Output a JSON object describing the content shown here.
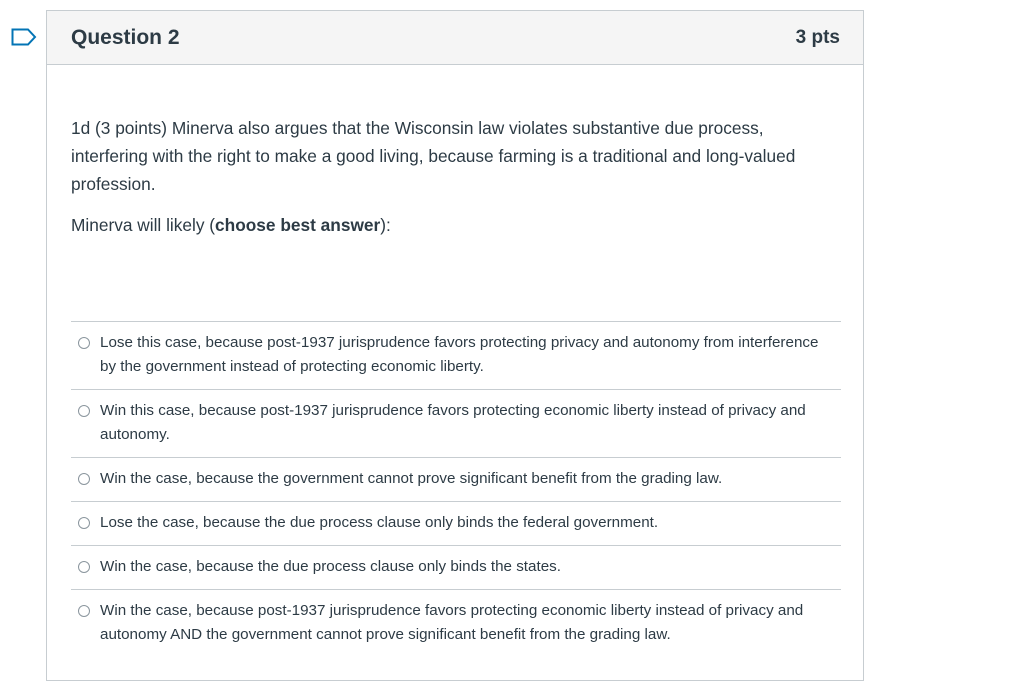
{
  "question": {
    "title": "Question 2",
    "points": "3 pts",
    "text": "1d (3 points) Minerva also argues that the Wisconsin law violates substantive due process, interfering with the right to make a good living, because farming is a traditional and long-valued profession.",
    "prompt_prefix": "Minerva will likely (",
    "prompt_bold": "choose best answer",
    "prompt_suffix": "):",
    "flagged": false
  },
  "answers": [
    {
      "label": "Lose this case, because post-1937 jurisprudence favors protecting privacy and autonomy from interference by the government instead of protecting economic liberty.",
      "selected": false
    },
    {
      "label": "Win this case, because post-1937 jurisprudence favors protecting economic liberty instead of privacy and autonomy.",
      "selected": false
    },
    {
      "label": "Win the case, because the government cannot prove significant benefit from the grading law.",
      "selected": false
    },
    {
      "label": "Lose the case, because the due process clause only binds the federal government.",
      "selected": false
    },
    {
      "label": "Win the case, because the due process clause only binds the states.",
      "selected": false
    },
    {
      "label": "Win the case, because post-1937 jurisprudence favors protecting economic liberty instead of privacy and autonomy AND the government cannot prove significant benefit from the grading law.",
      "selected": false
    }
  ],
  "colors": {
    "accent": "#0374b5",
    "text": "#2d3b45",
    "border": "#c7cdd1",
    "header_bg": "#f5f5f5"
  }
}
